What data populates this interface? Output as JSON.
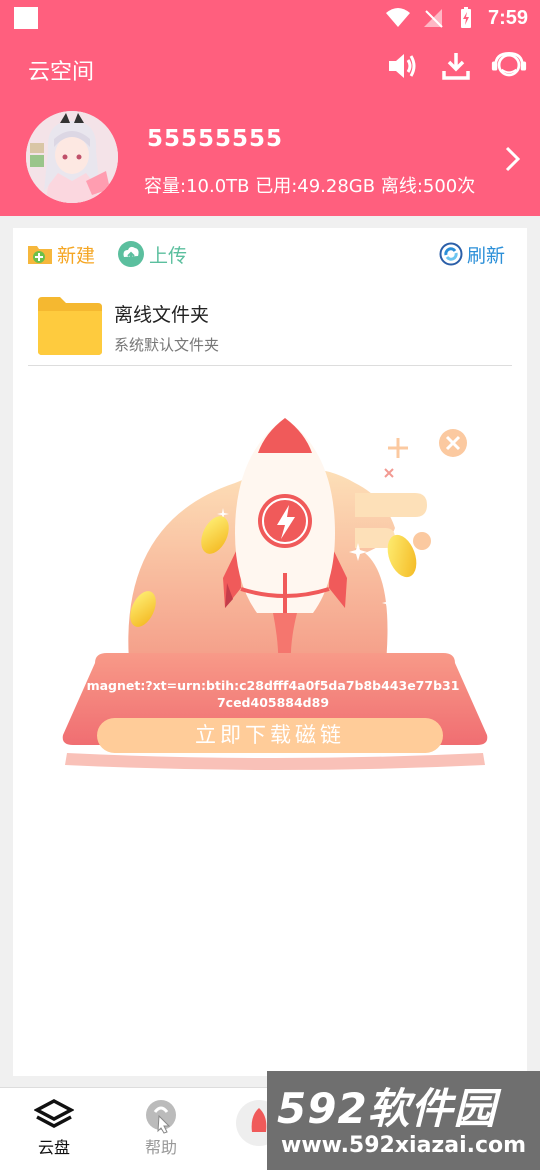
{
  "status_bar": {
    "time": "7:59"
  },
  "header": {
    "title": "云空间",
    "username": "55555555",
    "storage_info": "容量:10.0TB 已用:49.28GB 离线:500次"
  },
  "toolbar": {
    "new_label": "新建",
    "upload_label": "上传",
    "refresh_label": "刷新"
  },
  "folders": [
    {
      "name": "离线文件夹",
      "subtitle": "系统默认文件夹"
    }
  ],
  "promo": {
    "magnet_link": "magnet:?xt=urn:btih:c28dfff4a0f5da7b8b443e77b317ced405884d89",
    "download_button": "立即下载磁链"
  },
  "bottom_nav": [
    {
      "label": "云盘",
      "active": true
    },
    {
      "label": "帮助",
      "active": false
    }
  ],
  "watermark": {
    "brand": "592软件园",
    "url": "www.592xiazai.com"
  },
  "colors": {
    "accent": "#ff5f7e",
    "orange": "#f5a623",
    "green": "#5bbf9e",
    "blue": "#2b8fd8"
  }
}
